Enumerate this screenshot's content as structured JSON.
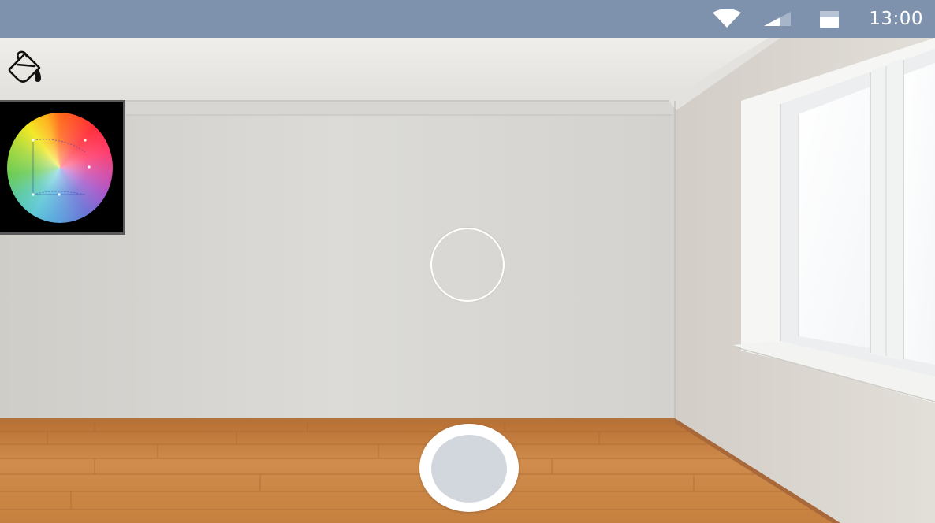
{
  "status_bar": {
    "time": "13:00",
    "icons": [
      "wifi-icon",
      "cellular-signal-icon",
      "battery-icon"
    ]
  },
  "toolbar": {
    "tool_icon": "paint-bucket-icon"
  },
  "color_picker": {
    "type": "color-wheel",
    "icon": "color-wheel"
  },
  "capture": {
    "selected_color": "#d1d7dd",
    "ring_color": "#ffffff"
  },
  "colors": {
    "status_bar_bg": "#7e92ad",
    "wall": "#d8d7d3",
    "floor": "#c98a4a",
    "reticle": "#ffffff"
  }
}
